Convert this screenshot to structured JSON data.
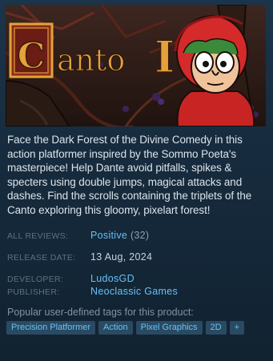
{
  "header_image": {
    "title_letter": "C",
    "title_text": "anto",
    "title_numeral": "I"
  },
  "description": "Face the Dark Forest of the Divine Comedy in this action platformer inspired by the Sommo Poeta's masterpiece! Help Dante avoid pitfalls, spikes & specters using double jumps, magical attacks and dashes. Find the scrolls containing the triplets of the Canto exploring this gloomy, pixelart forest!",
  "details": {
    "reviews_label": "ALL REVIEWS:",
    "reviews_value": "Positive",
    "reviews_count": "(32)",
    "release_label": "RELEASE DATE:",
    "release_value": "13 Aug, 2024",
    "developer_label": "DEVELOPER:",
    "developer_value": "LudosGD",
    "publisher_label": "PUBLISHER:",
    "publisher_value": "Neoclassic Games"
  },
  "tags_title": "Popular user-defined tags for this product:",
  "tags": [
    "Precision Platformer",
    "Action",
    "Pixel Graphics",
    "2D",
    "+"
  ],
  "colors": {
    "link": "#66c0f4",
    "tag_bg": "#2a4a62",
    "title_gold": "#e0a33a",
    "title_red": "#b71f1f"
  }
}
